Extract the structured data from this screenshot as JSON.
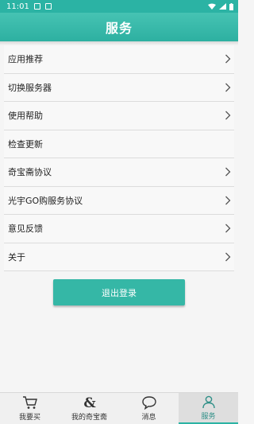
{
  "status_bar": {
    "time": "11:01"
  },
  "header": {
    "title": "服务"
  },
  "menu": {
    "items": [
      {
        "label": "应用推荐",
        "has_arrow": true
      },
      {
        "label": "切换服务器",
        "has_arrow": true
      },
      {
        "label": "使用帮助",
        "has_arrow": true
      },
      {
        "label": "检查更新",
        "has_arrow": false
      },
      {
        "label": "奇宝斋协议",
        "has_arrow": true
      },
      {
        "label": "光宇GO购服务协议",
        "has_arrow": true
      },
      {
        "label": "意见反馈",
        "has_arrow": true
      },
      {
        "label": "关于",
        "has_arrow": true
      }
    ]
  },
  "logout_button": {
    "label": "退出登录"
  },
  "bottom_nav": {
    "items": [
      {
        "label": "我要买",
        "icon": "cart-icon"
      },
      {
        "label": "我的奇宝斋",
        "icon": "ampersand-icon"
      },
      {
        "label": "消息",
        "icon": "chat-bubble-icon"
      },
      {
        "label": "服务",
        "icon": "user-icon"
      }
    ],
    "active_index": 3
  },
  "colors": {
    "accent": "#2bb3a4",
    "button": "#35b7a6"
  }
}
